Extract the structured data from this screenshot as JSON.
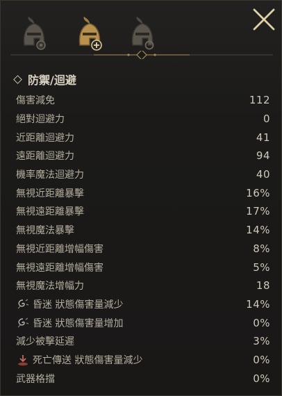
{
  "tabs": [
    {
      "icon": "helmet-gear-icon"
    },
    {
      "icon": "helmet-plus-icon",
      "active": true
    },
    {
      "icon": "helmet-ring-icon"
    }
  ],
  "section": {
    "title": "防禦/迴避"
  },
  "stats": [
    {
      "label": "傷害減免",
      "value": "112"
    },
    {
      "label": "絕對迴避力",
      "value": "0"
    },
    {
      "label": "近距離迴避力",
      "value": "41"
    },
    {
      "label": "遠距離迴避力",
      "value": "94"
    },
    {
      "label": "機率魔法迴避力",
      "value": "40"
    },
    {
      "label": "無視近距離暴擊",
      "value": "16%"
    },
    {
      "label": "無視遠距離暴擊",
      "value": "17%"
    },
    {
      "label": "無視魔法暴擊",
      "value": "14%"
    },
    {
      "label": "無視近距離增幅傷害",
      "value": "8%"
    },
    {
      "label": "無視遠距離增幅傷害",
      "value": "5%"
    },
    {
      "label": "無視魔法增幅力",
      "value": "18"
    },
    {
      "label": "昏迷 狀態傷害量減少",
      "value": "14%",
      "icon": "stun-icon"
    },
    {
      "label": "昏迷 狀態傷害量增加",
      "value": "0%",
      "icon": "stun-icon"
    },
    {
      "label": "減少被擊延遲",
      "value": "3%"
    },
    {
      "label": "死亡傳送 狀態傷害量減少",
      "value": "0%",
      "icon": "death-teleport-icon"
    },
    {
      "label": "武器格擋",
      "value": "0%"
    }
  ],
  "colors": {
    "accent": "#c9b27a",
    "background": "#1b1a19",
    "text": "#b4ad9f"
  }
}
